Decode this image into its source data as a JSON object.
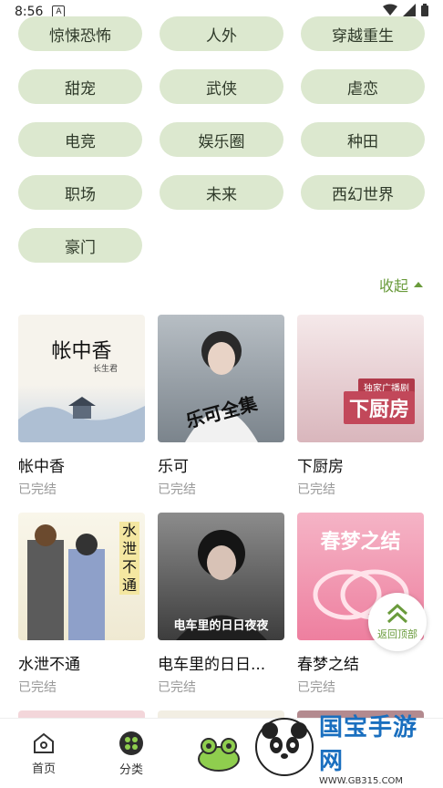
{
  "status_bar": {
    "time": "8:56",
    "notif_badge": "A"
  },
  "tags": [
    "惊悚恐怖",
    "人外",
    "穿越重生",
    "甜宠",
    "武侠",
    "虐恋",
    "电竞",
    "娱乐圈",
    "种田",
    "职场",
    "未来",
    "西幻世界",
    "豪门"
  ],
  "collapse_label": "收起",
  "books": [
    {
      "title": "帐中香",
      "status": "已完结",
      "cover_text": "帐中香",
      "cover_sub": "长生君"
    },
    {
      "title": "乐可",
      "status": "已完结",
      "cover_text": "乐可全集"
    },
    {
      "title": "下厨房",
      "status": "已完结",
      "cover_text": "下厨房",
      "cover_sub": "独家广播剧"
    },
    {
      "title": "水泄不通",
      "status": "已完结",
      "cover_text": "水泄不通"
    },
    {
      "title": "电车里的日日...",
      "status": "已完结",
      "cover_text": "电车里的日日夜夜"
    },
    {
      "title": "春梦之结",
      "status": "已完结",
      "cover_text": "春梦之结"
    }
  ],
  "back_to_top_label": "返回顶部",
  "nav": {
    "home": "首页",
    "category": "分类"
  },
  "watermark": {
    "main": "国宝手游网",
    "url": "WWW.GB315.COM"
  },
  "colors": {
    "accent": "#6a9b3c",
    "chip_bg": "#dce8cf"
  }
}
